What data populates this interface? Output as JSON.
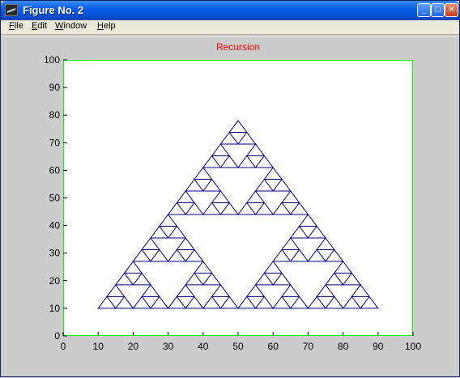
{
  "window": {
    "title": "Figure No. 2",
    "buttons": {
      "minimize": "_",
      "maximize": "□",
      "close": "✕"
    },
    "icon": "matlab-figure-icon"
  },
  "menu": {
    "items": [
      {
        "label": "File",
        "underline": "F",
        "rest": "ile"
      },
      {
        "label": "Edit",
        "underline": "E",
        "rest": "dit"
      },
      {
        "label": "Window",
        "underline": "W",
        "rest": "indow"
      },
      {
        "label": "Help",
        "underline": "H",
        "rest": "elp"
      }
    ]
  },
  "plot": {
    "title": "Recursion",
    "title_color": "#ff0000",
    "frame_color": "#00ff00",
    "line_color": "#000080"
  },
  "chart_data": {
    "type": "line",
    "title": "Recursion",
    "description_of_data": "Sierpinski triangle drawn by recursion",
    "outer_triangle": [
      [
        10,
        10
      ],
      [
        90,
        10
      ],
      [
        50,
        78
      ]
    ],
    "recursion_depth": 4,
    "xlim": [
      0,
      100
    ],
    "ylim": [
      0,
      100
    ],
    "xticks": [
      0,
      10,
      20,
      30,
      40,
      50,
      60,
      70,
      80,
      90,
      100
    ],
    "yticks": [
      0,
      10,
      20,
      30,
      40,
      50,
      60,
      70,
      80,
      90,
      100
    ],
    "grid": false
  }
}
